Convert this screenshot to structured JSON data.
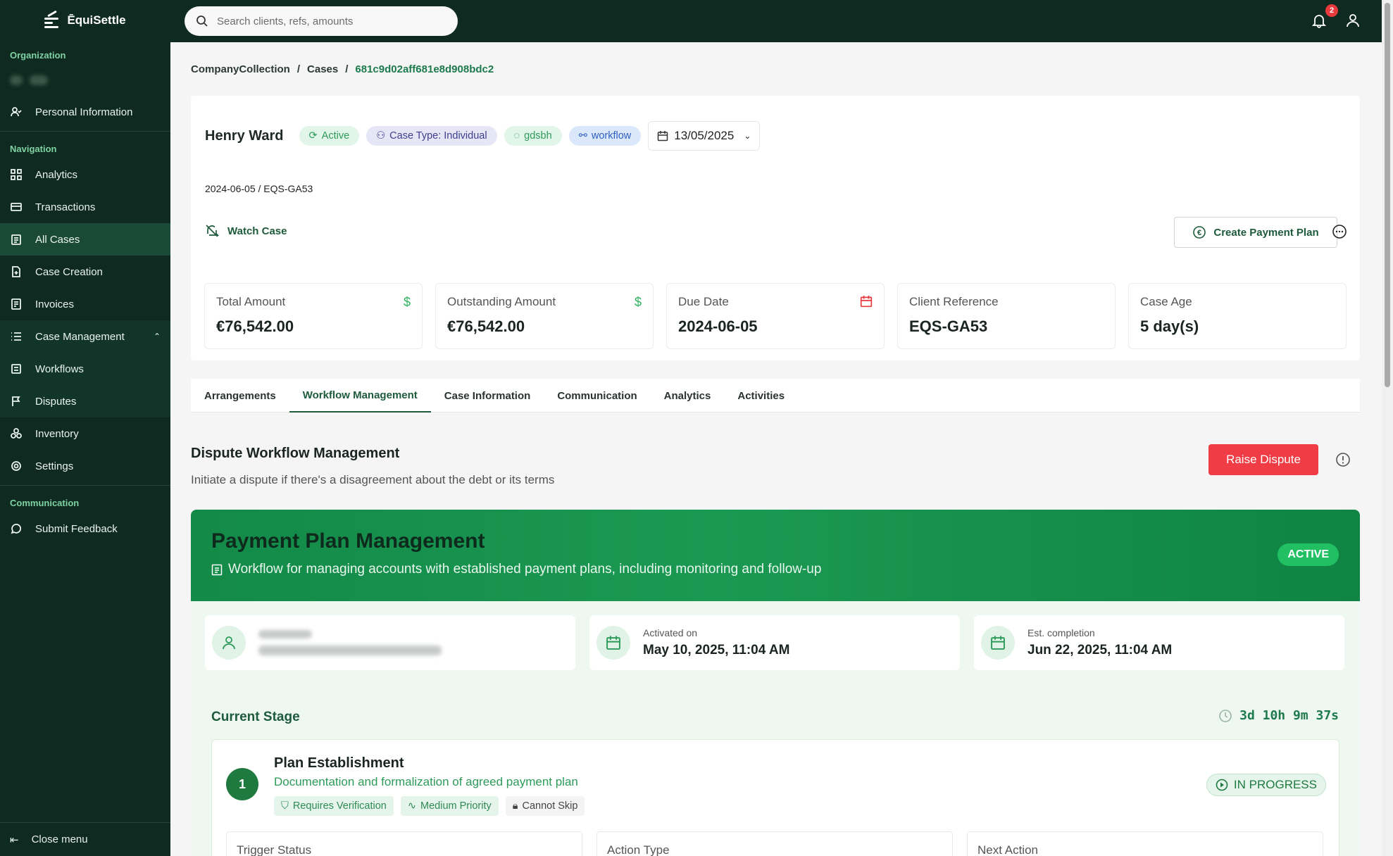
{
  "app": {
    "name": "ĒquiSettle"
  },
  "search": {
    "placeholder": "Search clients, refs, amounts"
  },
  "notifications": {
    "count": "2"
  },
  "sidebar": {
    "org_title": "Organization",
    "personal_info": "Personal Information",
    "nav_title": "Navigation",
    "items": [
      {
        "label": "Analytics"
      },
      {
        "label": "Transactions"
      },
      {
        "label": "All Cases"
      },
      {
        "label": "Case Creation"
      },
      {
        "label": "Invoices"
      },
      {
        "label": "Case Management"
      },
      {
        "label": "Workflows"
      },
      {
        "label": "Disputes"
      },
      {
        "label": "Inventory"
      },
      {
        "label": "Settings"
      }
    ],
    "comm_title": "Communication",
    "feedback": "Submit Feedback",
    "close_menu": "Close menu"
  },
  "breadcrumb": {
    "items": [
      "CompanyCollection",
      "Cases",
      "681c9d02aff681e8d908bdc2"
    ]
  },
  "case": {
    "name": "Henry Ward",
    "status": "Active",
    "case_type": "Case Type: Individual",
    "tag": "gdsbh",
    "workflow": "workflow",
    "date": "13/05/2025",
    "subtitle": "2024-06-05 / EQS-GA53",
    "watch": "Watch Case",
    "create_plan": "Create Payment Plan"
  },
  "stats": [
    {
      "label": "Total Amount",
      "value": "€76,542.00"
    },
    {
      "label": "Outstanding Amount",
      "value": "€76,542.00"
    },
    {
      "label": "Due Date",
      "value": "2024-06-05"
    },
    {
      "label": "Client Reference",
      "value": "EQS-GA53"
    },
    {
      "label": "Case Age",
      "value": "5 day(s)"
    }
  ],
  "tabs": [
    "Arrangements",
    "Workflow Management",
    "Case Information",
    "Communication",
    "Analytics",
    "Activities"
  ],
  "dispute": {
    "title": "Dispute Workflow Management",
    "subtitle": "Initiate a dispute if there's a disagreement about the debt or its terms",
    "raise": "Raise Dispute"
  },
  "workflow": {
    "title": "Payment Plan Management",
    "description": "Workflow for managing accounts with established payment plans, including monitoring and follow-up",
    "status": "ACTIVE",
    "activated_label": "Activated on",
    "activated_value": "May 10, 2025, 11:04 AM",
    "completion_label": "Est. completion",
    "completion_value": "Jun 22, 2025, 11:04 AM"
  },
  "stage": {
    "section_title": "Current Stage",
    "timer": "3d 10h 9m 37s",
    "number": "1",
    "name": "Plan Establishment",
    "description": "Documentation and formalization of agreed payment plan",
    "chips": [
      "Requires Verification",
      "Medium Priority",
      "Cannot Skip"
    ],
    "status": "IN PROGRESS",
    "fields": [
      "Trigger Status",
      "Action Type",
      "Next Action"
    ]
  },
  "colors": {
    "brand": "#0f2a20",
    "accent": "#1e7a4d",
    "danger": "#ef3c45",
    "active": "#20c063"
  }
}
